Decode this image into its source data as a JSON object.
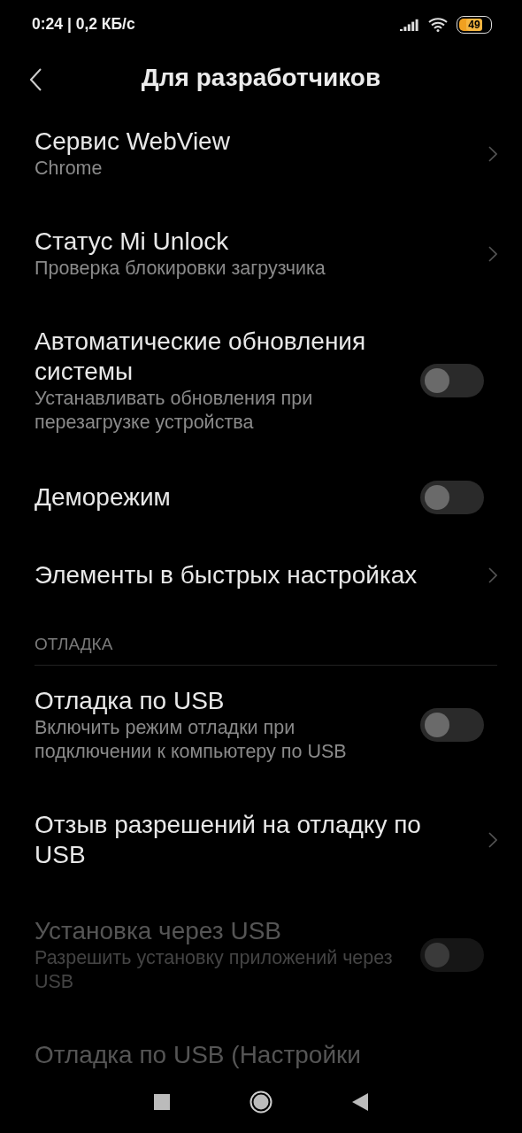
{
  "status_bar": {
    "time": "0:24 | 0,2 КБ/с",
    "battery": "49"
  },
  "header": {
    "title": "Для разработчиков"
  },
  "items": [
    {
      "kind": "link",
      "title": "Сервис WebView",
      "subtitle": "Chrome",
      "disabled": false
    },
    {
      "kind": "link",
      "title": "Статус Mi Unlock",
      "subtitle": "Проверка блокировки загрузчика",
      "disabled": false
    },
    {
      "kind": "toggle",
      "title": "Автоматические обновления системы",
      "subtitle": "Устанавливать обновления при перезагрузке устройства",
      "on": false,
      "disabled": false
    },
    {
      "kind": "toggle",
      "title": "Деморежим",
      "on": false,
      "disabled": false
    },
    {
      "kind": "link",
      "title": "Элементы в быстрых настройках",
      "disabled": false
    },
    {
      "kind": "section",
      "title": "ОТЛАДКА"
    },
    {
      "kind": "toggle",
      "title": "Отладка по USB",
      "subtitle": "Включить режим отладки при подключении к компьютеру по USB",
      "on": false,
      "disabled": false
    },
    {
      "kind": "link",
      "title": "Отзыв разрешений на отладку по USB",
      "disabled": false
    },
    {
      "kind": "toggle",
      "title": "Установка через USB",
      "subtitle": "Разрешить установку приложений через USB",
      "on": false,
      "disabled": true
    },
    {
      "kind": "plain",
      "title": "Отладка по USB (Настройки",
      "disabled": true
    }
  ]
}
